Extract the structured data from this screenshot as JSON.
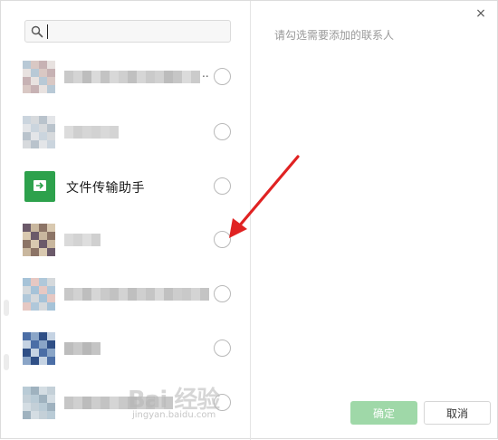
{
  "search": {
    "placeholder": "",
    "value": ""
  },
  "right_pane": {
    "hint": "请勾选需要添加的联系人"
  },
  "contacts": [
    {
      "name": "",
      "avatar_colors": [
        "#b8c9d6",
        "#d9c8c4",
        "#c7b2b4",
        "#e8e2e0"
      ],
      "blur_colors": [
        "#c9c9c9",
        "#d4d4d4",
        "#bdbdbd",
        "#dadada",
        "#c3c3c3",
        "#d8d8d8",
        "#cfcfcf",
        "#c0c0c0",
        "#d6d6d6",
        "#cacaca",
        "#d1d1d1",
        "#bcbcbc",
        "#c6c6c6",
        "#dbdbdb",
        "#cbcbcb"
      ],
      "ellipsis": "..",
      "selected": false
    },
    {
      "name": "",
      "avatar_colors": [
        "#cbd5de",
        "#d7dadd",
        "#b9c3cc",
        "#e3e5e8"
      ],
      "blur_colors": [
        "#dcdcdc",
        "#cfcfcf",
        "#d6d6d6",
        "#d2d2d2",
        "#d9d9d9",
        "#d4d4d4"
      ],
      "selected": false
    },
    {
      "name": "文件传输助手",
      "avatar_color": "#2da14c",
      "selected": false
    },
    {
      "name": "",
      "avatar_colors": [
        "#6b5a6a",
        "#c9b79e",
        "#8c7466",
        "#d9c9b0"
      ],
      "blur_colors": [
        "#dadada",
        "#d3d3d3",
        "#dedede",
        "#d0d0d0"
      ],
      "selected": false
    },
    {
      "name": "",
      "avatar_colors": [
        "#a6c3d8",
        "#e6c8c3",
        "#b0c8da",
        "#d5d9dc"
      ],
      "blur_colors": [
        "#c8c8c8",
        "#d2d2d2",
        "#bebebe",
        "#d6d6d6",
        "#cacaca",
        "#c2c2c2",
        "#d3d3d3",
        "#bfbfbf",
        "#cfcfcf",
        "#c5c5c5",
        "#d8d8d8",
        "#c1c1c1",
        "#cdcdcd",
        "#c9c9c9",
        "#d4d4d4",
        "#c4c4c4"
      ],
      "selected": false
    },
    {
      "name": "",
      "avatar_colors": [
        "#4b6ea6",
        "#8aa5c7",
        "#2f4f86",
        "#c5d3e3"
      ],
      "blur_colors": [
        "#bdbdbd",
        "#c8c8c8",
        "#b7b7b7",
        "#c4c4c4"
      ],
      "selected": false
    },
    {
      "name": "",
      "avatar_colors": [
        "#b9cbd6",
        "#9fb2bf",
        "#d4dde3",
        "#c4d0d8"
      ],
      "blur_colors": [
        "#c6c6c6",
        "#d0d0d0",
        "#bcbcbc",
        "#cdcdcd",
        "#c3c3c3",
        "#d5d5d5",
        "#c9c9c9",
        "#bfbfbf",
        "#cccccc",
        "#c2c2c2",
        "#d2d2d2",
        "#c7c7c7"
      ],
      "selected": false
    }
  ],
  "buttons": {
    "confirm": "确定",
    "cancel": "取消",
    "close": "×"
  },
  "watermark": {
    "text": "Bai 经验",
    "sub": "jingyan.baidu.com"
  },
  "annotation": {
    "arrow_color": "#e02222"
  },
  "icons": {
    "search": "search-icon",
    "close": "close-icon",
    "file_transfer": "file-transfer-icon"
  }
}
